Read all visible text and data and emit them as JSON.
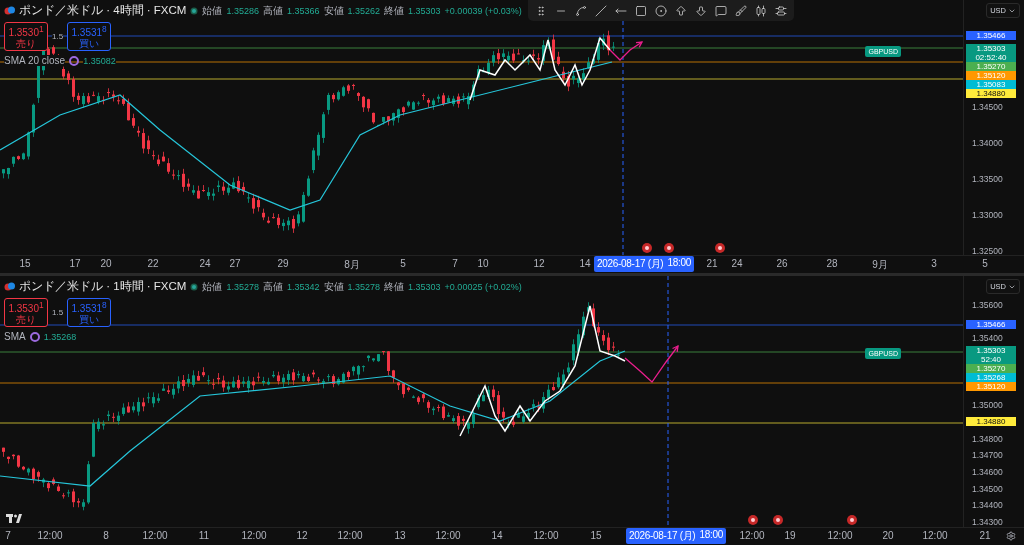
{
  "panes": [
    {
      "title": "ポンド／米ドル · 4時間 · FXCM",
      "ohlc": [
        {
          "label": "始値",
          "value": "1.35286"
        },
        {
          "label": "高値",
          "value": "1.35366"
        },
        {
          "label": "安値",
          "value": "1.35262"
        },
        {
          "label": "終値",
          "value": "1.35303"
        }
      ],
      "change": "+0.00039 (+0.03%)",
      "sell": {
        "price": "1.3530$^{1}$",
        "label": "売り"
      },
      "spread": "1.5",
      "buy": {
        "price": "1.3531$^{8}$",
        "label": "買い"
      },
      "indicator": {
        "name": "SMA 20 close",
        "value": "1.35082"
      },
      "currency": "USD",
      "price_ticks": [
        "1.34500",
        "1.34000",
        "1.33500",
        "1.33000",
        "1.32500"
      ],
      "price_tags": [
        {
          "text": "1.35466",
          "color": "#2962ff"
        },
        {
          "text": "1.35303",
          "symbol": "GBPUSD",
          "countdown": "02:52:40",
          "color": "#089981"
        },
        {
          "text": "1.35270",
          "color": "#4caf50"
        },
        {
          "text": "1.35120",
          "color": "#ff9800"
        },
        {
          "text": "1.35083",
          "color": "#00bcd4"
        },
        {
          "text": "1.34880",
          "color": "#ffeb3b"
        }
      ],
      "time_labels": [
        "15",
        "17",
        "20",
        "22",
        "24",
        "27",
        "29",
        "8月",
        "5",
        "7",
        "10",
        "12",
        "14",
        "21",
        "24",
        "26",
        "28",
        "9月",
        "3",
        "5"
      ],
      "cursor_time": "2026-08-17 (月)",
      "cursor_clock": "18:00"
    },
    {
      "title": "ポンド／米ドル · 1時間 · FXCM",
      "ohlc": [
        {
          "label": "始値",
          "value": "1.35278"
        },
        {
          "label": "高値",
          "value": "1.35342"
        },
        {
          "label": "安値",
          "value": "1.35278"
        },
        {
          "label": "終値",
          "value": "1.35303"
        }
      ],
      "change": "+0.00025 (+0.02%)",
      "sell": {
        "price": "1.3530$^{1}$",
        "label": "売り"
      },
      "spread": "1.5",
      "buy": {
        "price": "1.3531$^{8}$",
        "label": "買い"
      },
      "indicator": {
        "name": "SMA",
        "value": "1.35268"
      },
      "currency": "USD",
      "price_ticks": [
        "1.35600",
        "1.35400",
        "1.35000",
        "1.34800",
        "1.34700",
        "1.34600",
        "1.34500",
        "1.34400",
        "1.34300"
      ],
      "price_tags": [
        {
          "text": "1.35466",
          "color": "#2962ff"
        },
        {
          "text": "1.35303",
          "symbol": "GBPUSD",
          "countdown": "52:40",
          "color": "#089981"
        },
        {
          "text": "1.35270",
          "color": "#4caf50"
        },
        {
          "text": "1.35268",
          "color": "#00bcd4"
        },
        {
          "text": "1.35120",
          "color": "#ff9800"
        },
        {
          "text": "1.34880",
          "color": "#ffeb3b"
        }
      ],
      "time_labels": [
        "7",
        "12:00",
        "8",
        "12:00",
        "11",
        "12:00",
        "12",
        "12:00",
        "13",
        "12:00",
        "14",
        "12:00",
        "15",
        "12:00",
        "19",
        "12:00",
        "20",
        "12:00",
        "21"
      ],
      "cursor_time": "2026-08-17 (月)",
      "cursor_clock": "18:00"
    }
  ]
}
